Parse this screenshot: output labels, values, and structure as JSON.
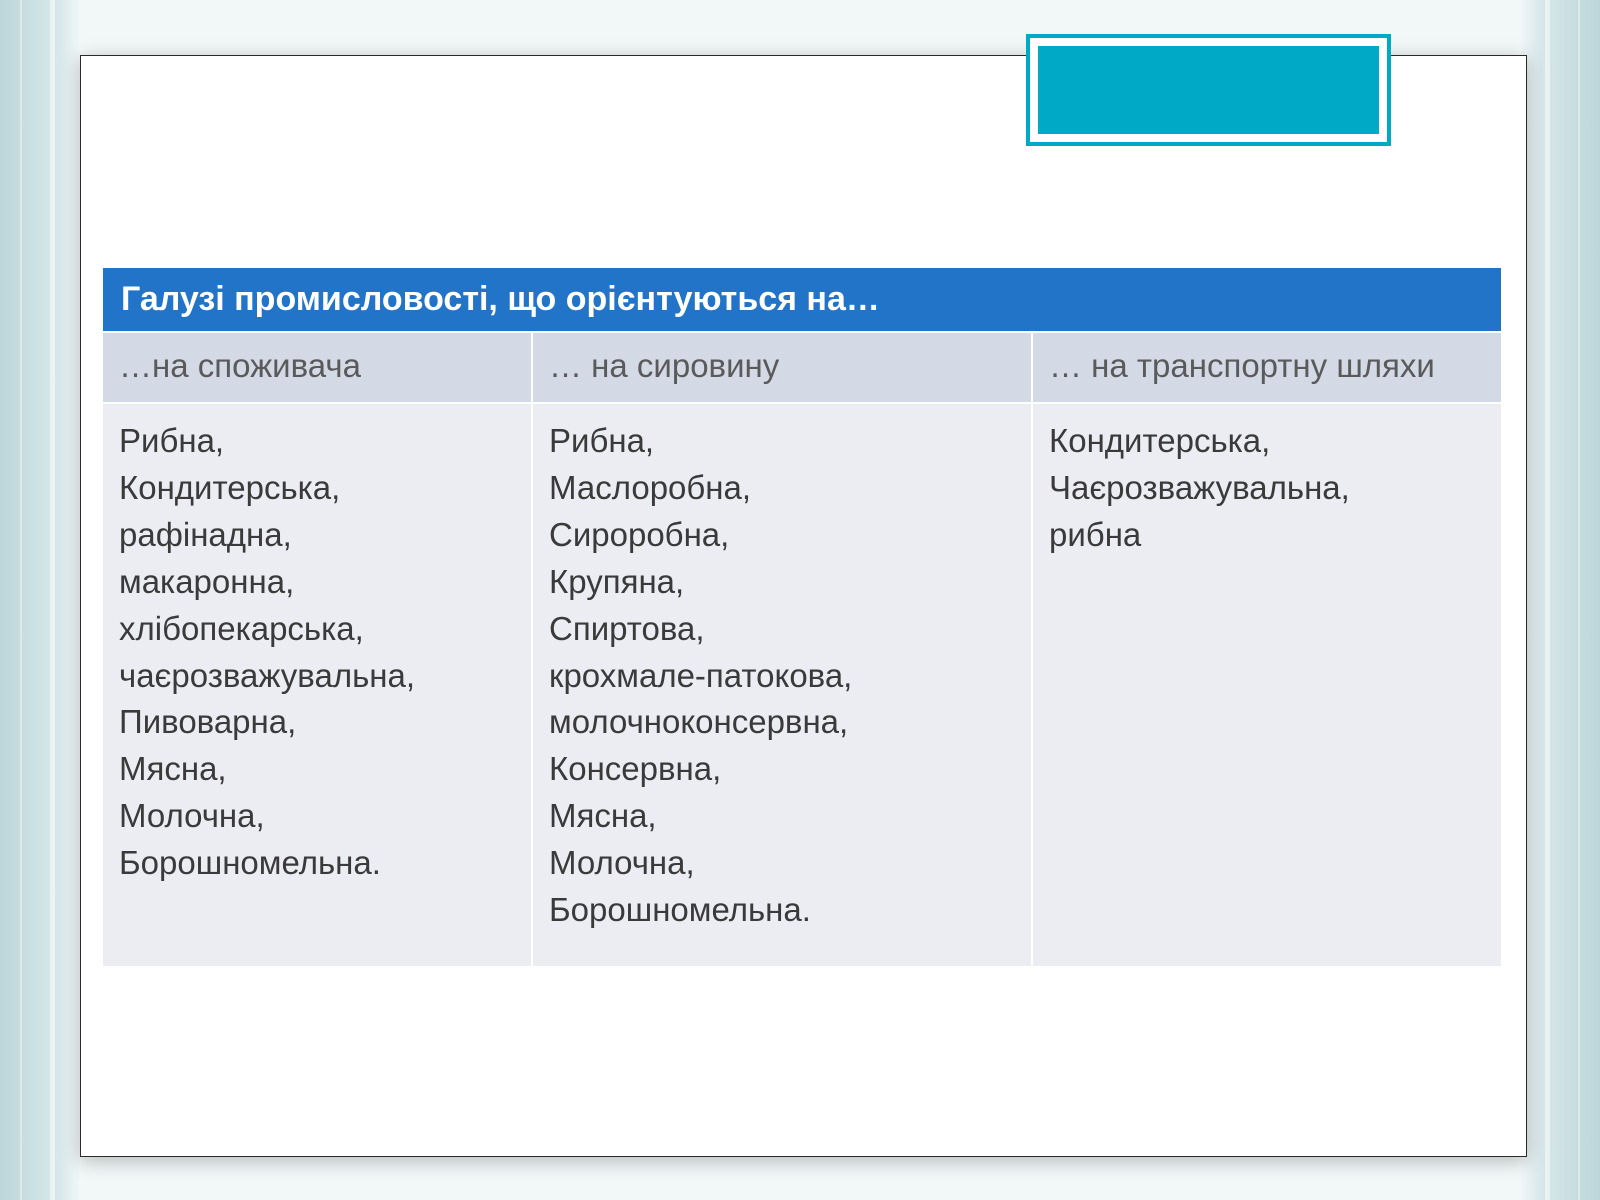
{
  "table": {
    "title": "Галузі промисловості, що орієнтуються на…",
    "headers": {
      "col1": "…на споживача",
      "col2": "… на сировину",
      "col3": "… на транспортну шляхи"
    },
    "cells": {
      "col1": [
        "Рибна,",
        "Кондитерська,",
        "рафінадна,",
        "макаронна,",
        "хлібопекарська,",
        "чаєрозважувальна,",
        "Пивоварна,",
        "Мясна,",
        "Молочна,",
        "Борошномельна."
      ],
      "col2": [
        "Рибна,",
        "Маслоробна,",
        "Сироробна,",
        "Крупяна,",
        "Спиртова,",
        "крохмале-патокова,",
        "молочноконсервна,",
        "Консервна,",
        "Мясна,",
        "Молочна,",
        "Борошномельна."
      ],
      "col3": [
        "Кондитерська,",
        "Чаєрозважувальна,",
        "рибна"
      ]
    }
  }
}
